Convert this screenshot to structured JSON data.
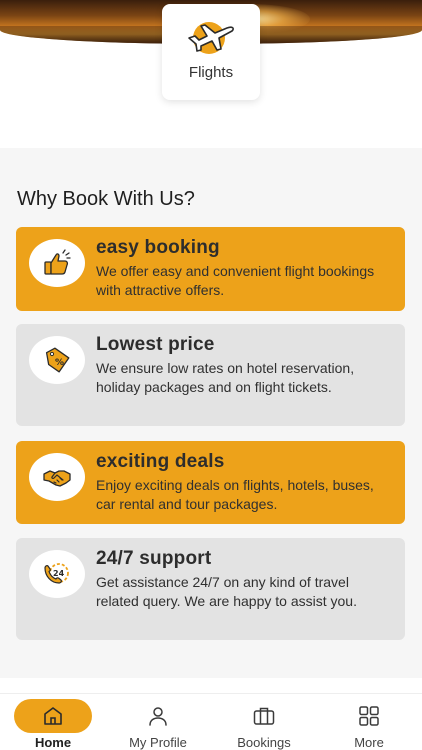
{
  "top_card": {
    "label": "Flights",
    "icon": "airplane-icon"
  },
  "section": {
    "title": "Why Book With Us?",
    "features": [
      {
        "title": "easy booking",
        "desc": "We offer easy and convenient flight bookings with attractive offers.",
        "icon": "thumbs-up-icon",
        "style": "orange"
      },
      {
        "title": "Lowest price",
        "desc": "We ensure low rates on hotel reservation, holiday packages and on flight tickets.",
        "icon": "price-tag-icon",
        "style": "grey"
      },
      {
        "title": "exciting deals",
        "desc": "Enjoy exciting deals on flights, hotels, buses, car rental and tour packages.",
        "icon": "handshake-icon",
        "style": "orange"
      },
      {
        "title": "24/7 support",
        "desc": "Get assistance 24/7 on any kind of travel related query. We are happy to assist you.",
        "icon": "support-24-icon",
        "style": "grey"
      }
    ]
  },
  "badge_24": "24",
  "nav": {
    "items": [
      {
        "label": "Home",
        "icon": "home-icon",
        "active": true
      },
      {
        "label": "My Profile",
        "icon": "person-icon",
        "active": false
      },
      {
        "label": "Bookings",
        "icon": "briefcase-icon",
        "active": false
      },
      {
        "label": "More",
        "icon": "grid-icon",
        "active": false
      }
    ]
  },
  "colors": {
    "accent": "#eda21a",
    "card_grey": "#e3e3e3",
    "background": "#f6f6f6"
  }
}
